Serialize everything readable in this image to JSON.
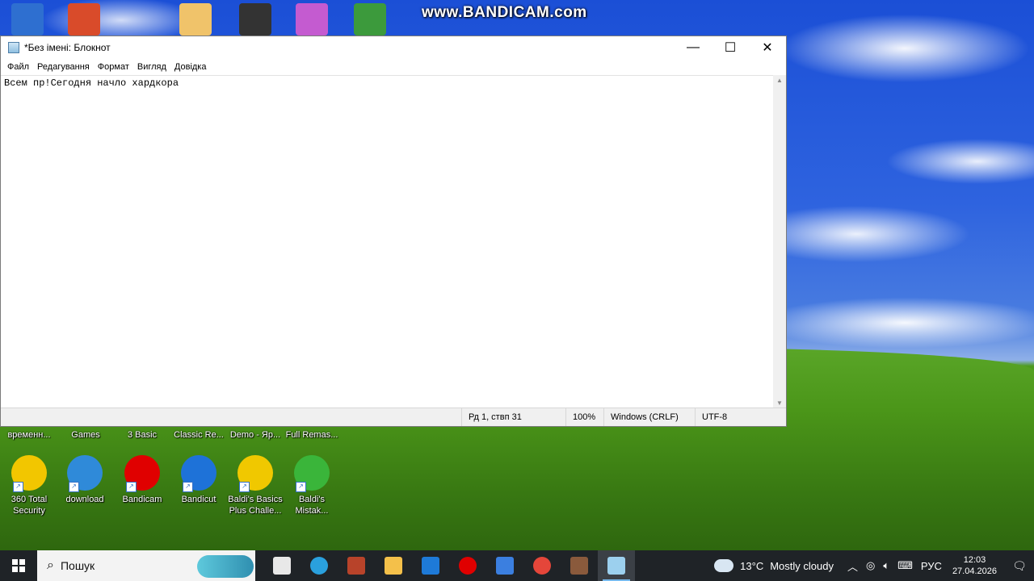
{
  "watermark": "www.BANDICAM.com",
  "notepad": {
    "title": "*Без імені: Блокнот",
    "menu": [
      "Файл",
      "Редагування",
      "Формат",
      "Вигляд",
      "Довідка"
    ],
    "content": "Всем пр!Сегодня начло хардкора",
    "status": {
      "position": "Рд 1, ствп 31",
      "zoom": "100%",
      "line_endings": "Windows (CRLF)",
      "encoding": "UTF-8"
    },
    "buttons": {
      "minimize": "—",
      "maximize": "☐",
      "close": "✕"
    }
  },
  "desktop": {
    "partial_labels": [
      "временн...",
      "Games",
      "3 Basic",
      "Classic Re...",
      "Demo - Яр...",
      "Full Remas..."
    ],
    "icons": [
      {
        "label": "360 Total Security",
        "icon": "plus-shield-icon",
        "color": "#f2c600"
      },
      {
        "label": "download",
        "icon": "globe-icon",
        "color": "#2f8ad9"
      },
      {
        "label": "Bandicam",
        "icon": "record-icon",
        "color": "#e00000"
      },
      {
        "label": "Bandicut",
        "icon": "film-icon",
        "color": "#1e72d8"
      },
      {
        "label": "Baldi's Basics Plus Challe...",
        "icon": "baldi-icon",
        "color": "#f0c800"
      },
      {
        "label": "Baldi's Mistak...",
        "icon": "baldi-green-icon",
        "color": "#3ab53a"
      }
    ],
    "top_icons": [
      {
        "icon": "window-app-icon",
        "color": "#2e6fd0"
      },
      {
        "icon": "avg-icon",
        "color": "#d94b2a"
      },
      {
        "icon": "door-icon",
        "color": "#f0c36a"
      },
      {
        "icon": "unity-icon",
        "color": "#333"
      },
      {
        "icon": "character-icon",
        "color": "#c45bd0"
      },
      {
        "icon": "game-icon",
        "color": "#3c9a3c"
      }
    ]
  },
  "taskbar": {
    "search_placeholder": "Пошук",
    "apps": [
      {
        "icon": "store-icon",
        "color": "#e8e8e8"
      },
      {
        "icon": "edge-icon",
        "color": "#2aa0dd"
      },
      {
        "icon": "wot-icon",
        "color": "#b8432a"
      },
      {
        "icon": "folder-icon",
        "color": "#f4c04a"
      },
      {
        "icon": "mail-icon",
        "color": "#1e7ad8"
      },
      {
        "icon": "bandicam-icon",
        "color": "#e00000"
      },
      {
        "icon": "window-app-icon",
        "color": "#3b7fe0"
      },
      {
        "icon": "chrome-icon",
        "color": "#e5463a"
      },
      {
        "icon": "minecraft-icon",
        "color": "#8a5a3c"
      },
      {
        "icon": "notepad-icon",
        "color": "#9cd0ee"
      }
    ],
    "weather": {
      "temp": "13°C",
      "condition": "Mostly cloudy"
    },
    "language": "РУС",
    "time": "12:03",
    "date": "27.04.2026"
  }
}
